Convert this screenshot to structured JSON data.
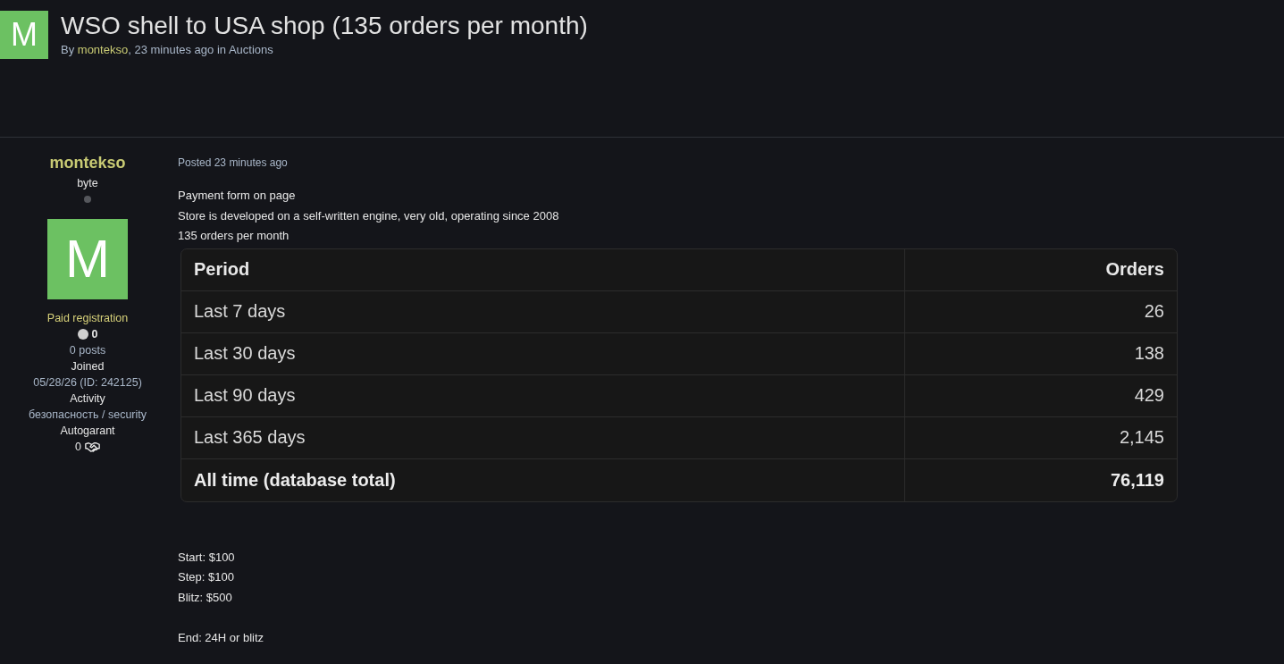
{
  "topic": {
    "avatar_letter": "M",
    "title": "WSO shell to USA shop (135 orders per month)",
    "byline": {
      "prefix": "By",
      "author": "montekso",
      "middle": ", 23 minutes ago in",
      "forum": "Auctions"
    }
  },
  "author_panel": {
    "name": "montekso",
    "rank": "byte",
    "online": false,
    "avatar_letter": "M",
    "group": "Paid registration",
    "reputation": "0",
    "posts": "0 posts",
    "fields": [
      {
        "label": "Joined",
        "value": "05/28/26 (ID: 242125)",
        "kind": "text"
      },
      {
        "label": "Activity",
        "value": "безопасность / security",
        "kind": "text"
      },
      {
        "label": "Autogarant",
        "value": "0",
        "kind": "deals"
      }
    ]
  },
  "post": {
    "posted": "Posted 23 minutes ago",
    "blocks": [
      {
        "kind": "text",
        "lines": [
          "Payment form on page",
          "Store is developed on a self-written engine, very old, operating since 2008",
          "135 orders per month"
        ]
      },
      {
        "kind": "table",
        "columns": [
          "Period",
          "Orders"
        ],
        "rows": [
          {
            "kind": "normal",
            "period": "Last 7 days",
            "orders": "26"
          },
          {
            "kind": "normal",
            "period": "Last 30 days",
            "orders": "138"
          },
          {
            "kind": "normal",
            "period": "Last 90 days",
            "orders": "429"
          },
          {
            "kind": "normal",
            "period": "Last 365 days",
            "orders": "2,145"
          },
          {
            "kind": "total",
            "period": "All time (database total)",
            "orders": "76,119"
          }
        ]
      },
      {
        "kind": "text",
        "lines": [
          "Start: $100",
          "Step: $100",
          "Blitz: $500"
        ]
      },
      {
        "kind": "text",
        "lines": [
          "End: 24H or blitz"
        ]
      }
    ]
  }
}
